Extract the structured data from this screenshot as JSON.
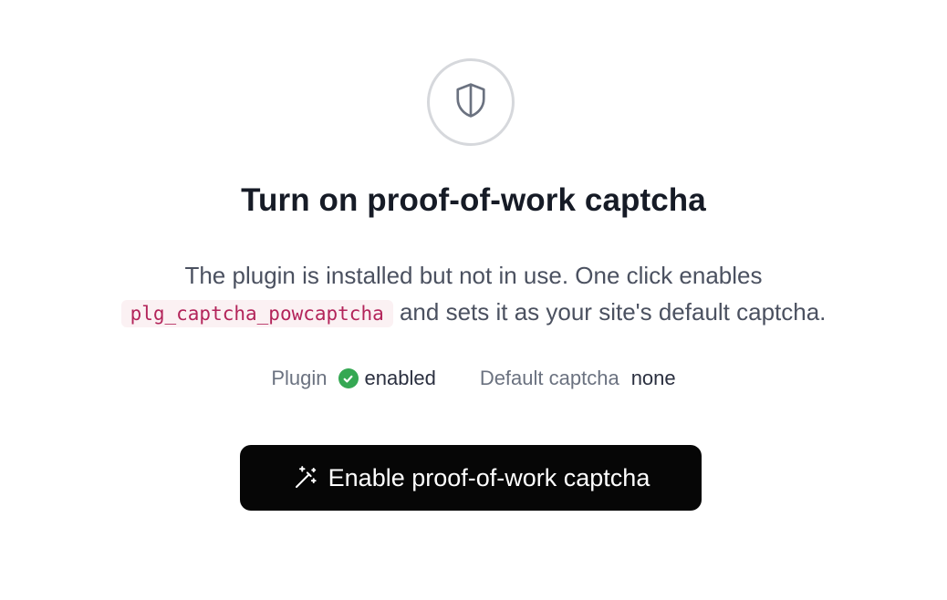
{
  "hero": {
    "icon": "shield-icon",
    "title": "Turn on proof-of-work captcha",
    "description_before": "The plugin is installed but not in use. One click enables",
    "plugin_code": "plg_captcha_powcaptcha",
    "description_after": "and sets it as your site's default captcha."
  },
  "status": {
    "plugin_label": "Plugin",
    "plugin_value": "enabled",
    "plugin_icon": "check-circle-icon",
    "captcha_label": "Default captcha",
    "captcha_value": "none"
  },
  "action": {
    "button_label": "Enable proof-of-work captcha",
    "button_icon": "magic-wand-icon"
  },
  "colors": {
    "button_bg": "#060606",
    "success": "#35a853",
    "code_text": "#b3245a",
    "code_bg": "#fbf1f3"
  }
}
